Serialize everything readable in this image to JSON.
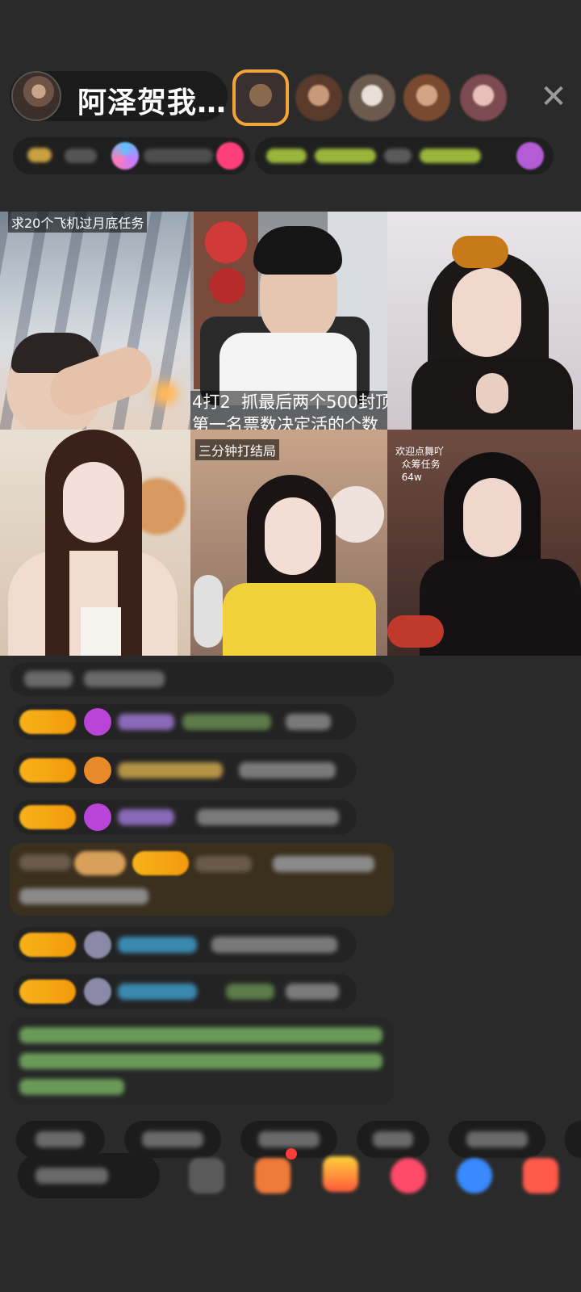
{
  "header": {
    "host_name": "阿泽贺我…",
    "close_icon": "close-icon",
    "colors": {
      "accent": "#f0a43a",
      "pill_bg": "#1b1b1b"
    }
  },
  "grid": {
    "tiles": [
      {
        "caption": "求20个飞机过月底任务"
      },
      {
        "caption": "4打2  抓最后两个500封顶\n第一名票数决定活的个数"
      },
      {
        "caption": ""
      },
      {
        "caption": ""
      },
      {
        "caption": "三分钟打结局"
      },
      {
        "caption": "欢迎点舞吖\n  众筹任务\n  64w"
      }
    ]
  },
  "chat": {
    "level_color": "#f7b21a",
    "gift_bg": "#3b2f1e"
  },
  "bottom": {
    "input_icon": "chat-input",
    "tool_icons": [
      "emoji-icon",
      "gift-box-icon",
      "gift-icon",
      "heart-icon",
      "message-icon",
      "more-icon"
    ]
  }
}
